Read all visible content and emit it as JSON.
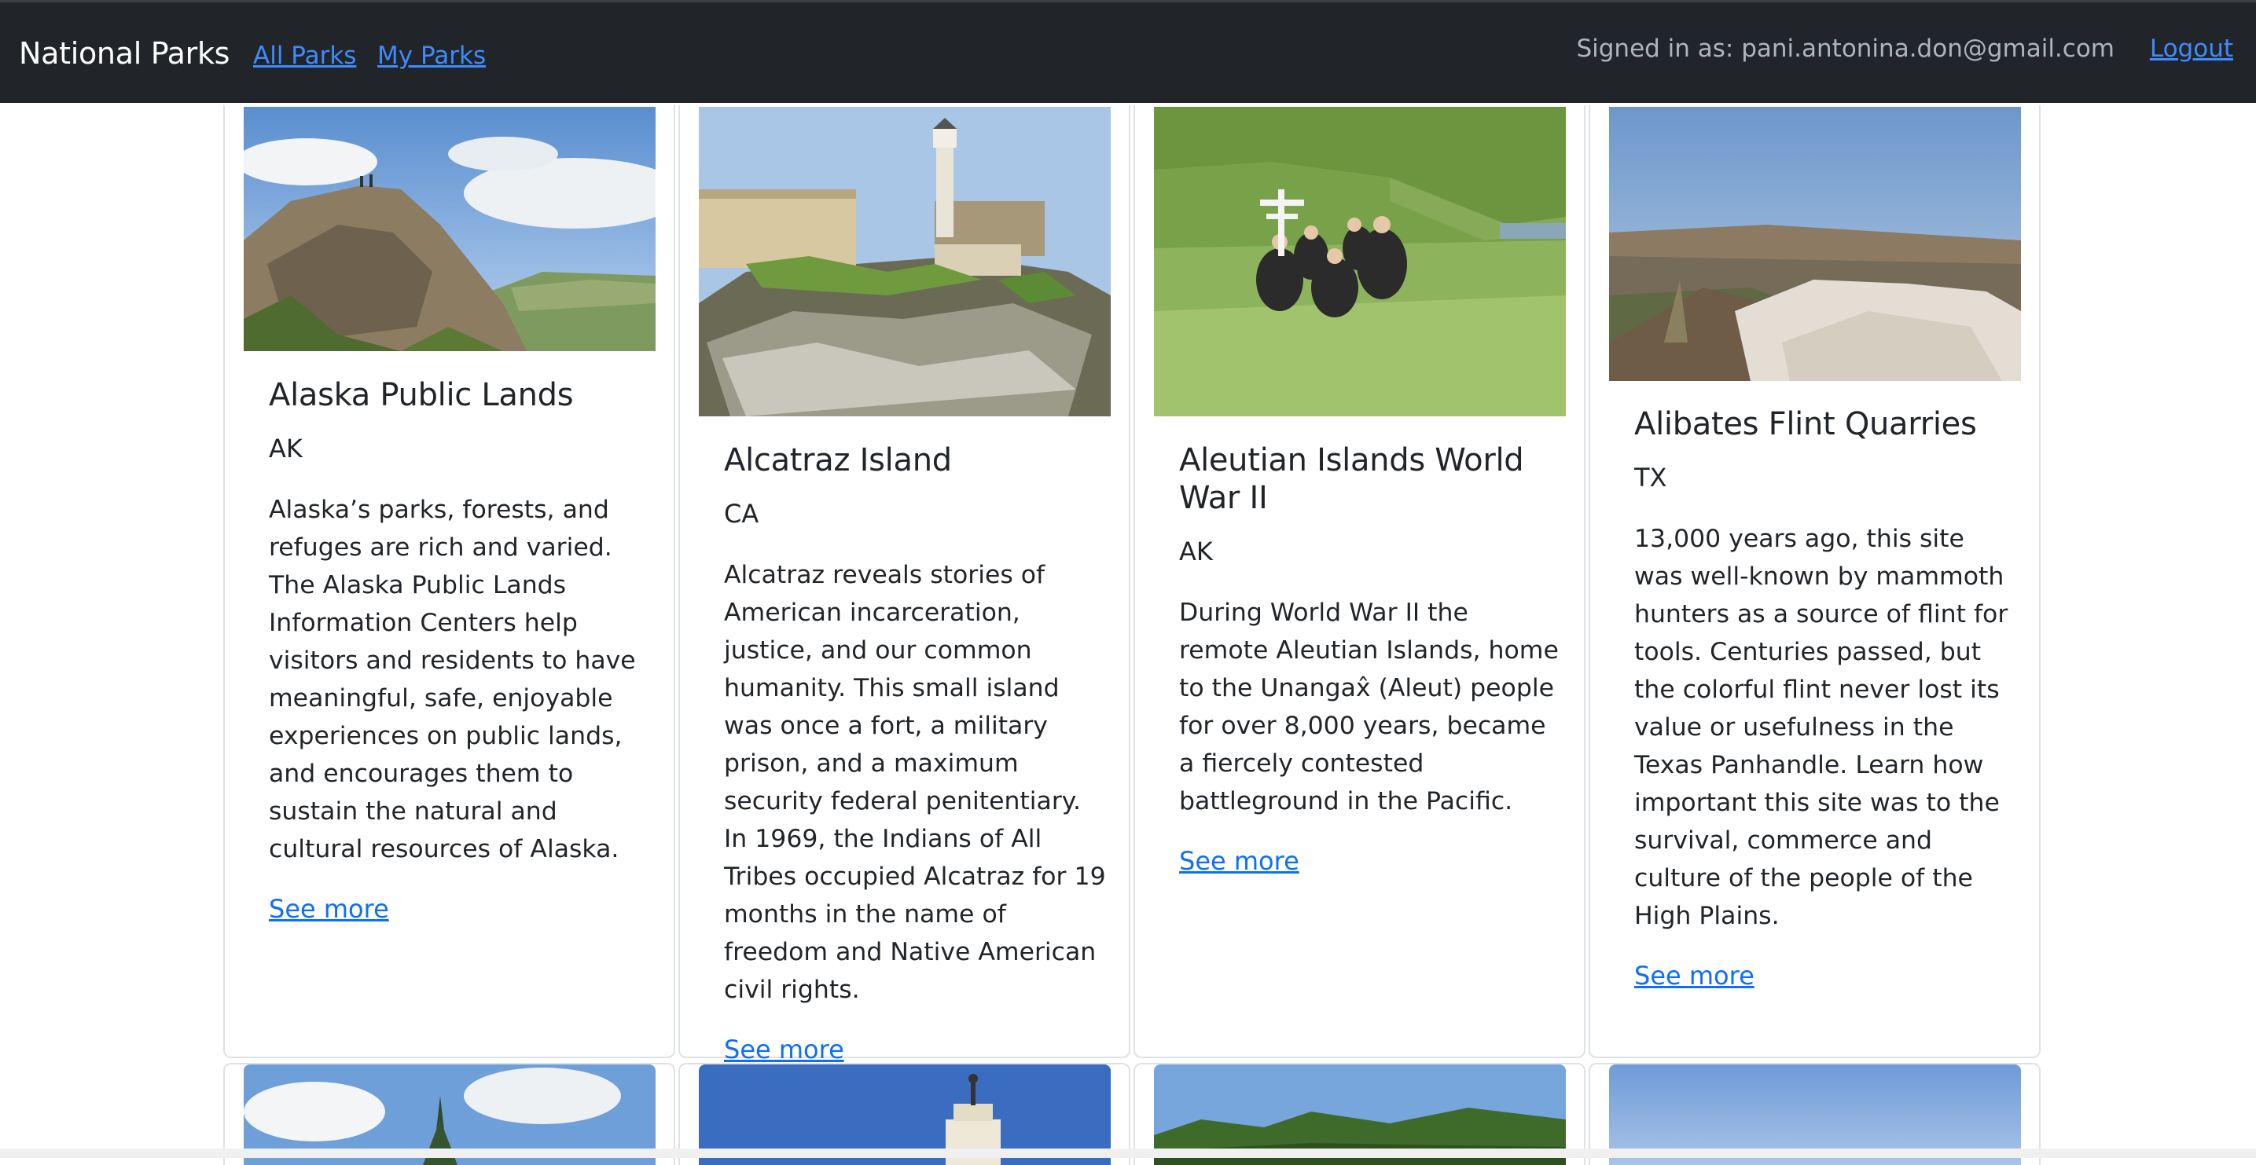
{
  "navbar": {
    "brand": "National Parks",
    "links": [
      "All Parks",
      "My Parks"
    ],
    "signed_in": "Signed in as: pani.antonina.don@gmail.com",
    "logout": "Logout"
  },
  "parks": [
    {
      "name": "Alaska Public Lands",
      "state": "AK",
      "description": "Alaska’s parks, forests, and refuges are rich and varied. The Alaska Public Lands Information Centers help visitors and residents to have meaningful, safe, enjoyable experiences on public lands, and encourages them to sustain the natural and cultural resources of Alaska.",
      "link": "See more"
    },
    {
      "name": "Alcatraz Island",
      "state": "CA",
      "description": "Alcatraz reveals stories of American incarceration, justice, and our common humanity. This small island was once a fort, a military prison, and a maximum security federal penitentiary. In 1969, the Indians of All Tribes occupied Alcatraz for 19 months in the name of freedom and Native American civil rights.",
      "link": "See more"
    },
    {
      "name": "Aleutian Islands World War II",
      "state": "AK",
      "description": "During World War II the remote Aleutian Islands, home to the Unangax̂ (Aleut) people for over 8,000 years, became a fiercely contested battleground in the Pacific.",
      "link": "See more"
    },
    {
      "name": "Alibates Flint Quarries",
      "state": "TX",
      "description": "13,000 years ago, this site was well-known by mammoth hunters as a source of flint for tools. Centuries passed, but the colorful flint never lost its value or usefulness in the Texas Panhandle. Learn how important this site was to the survival, commerce and culture of the people of the High Plains.",
      "link": "See more"
    }
  ]
}
